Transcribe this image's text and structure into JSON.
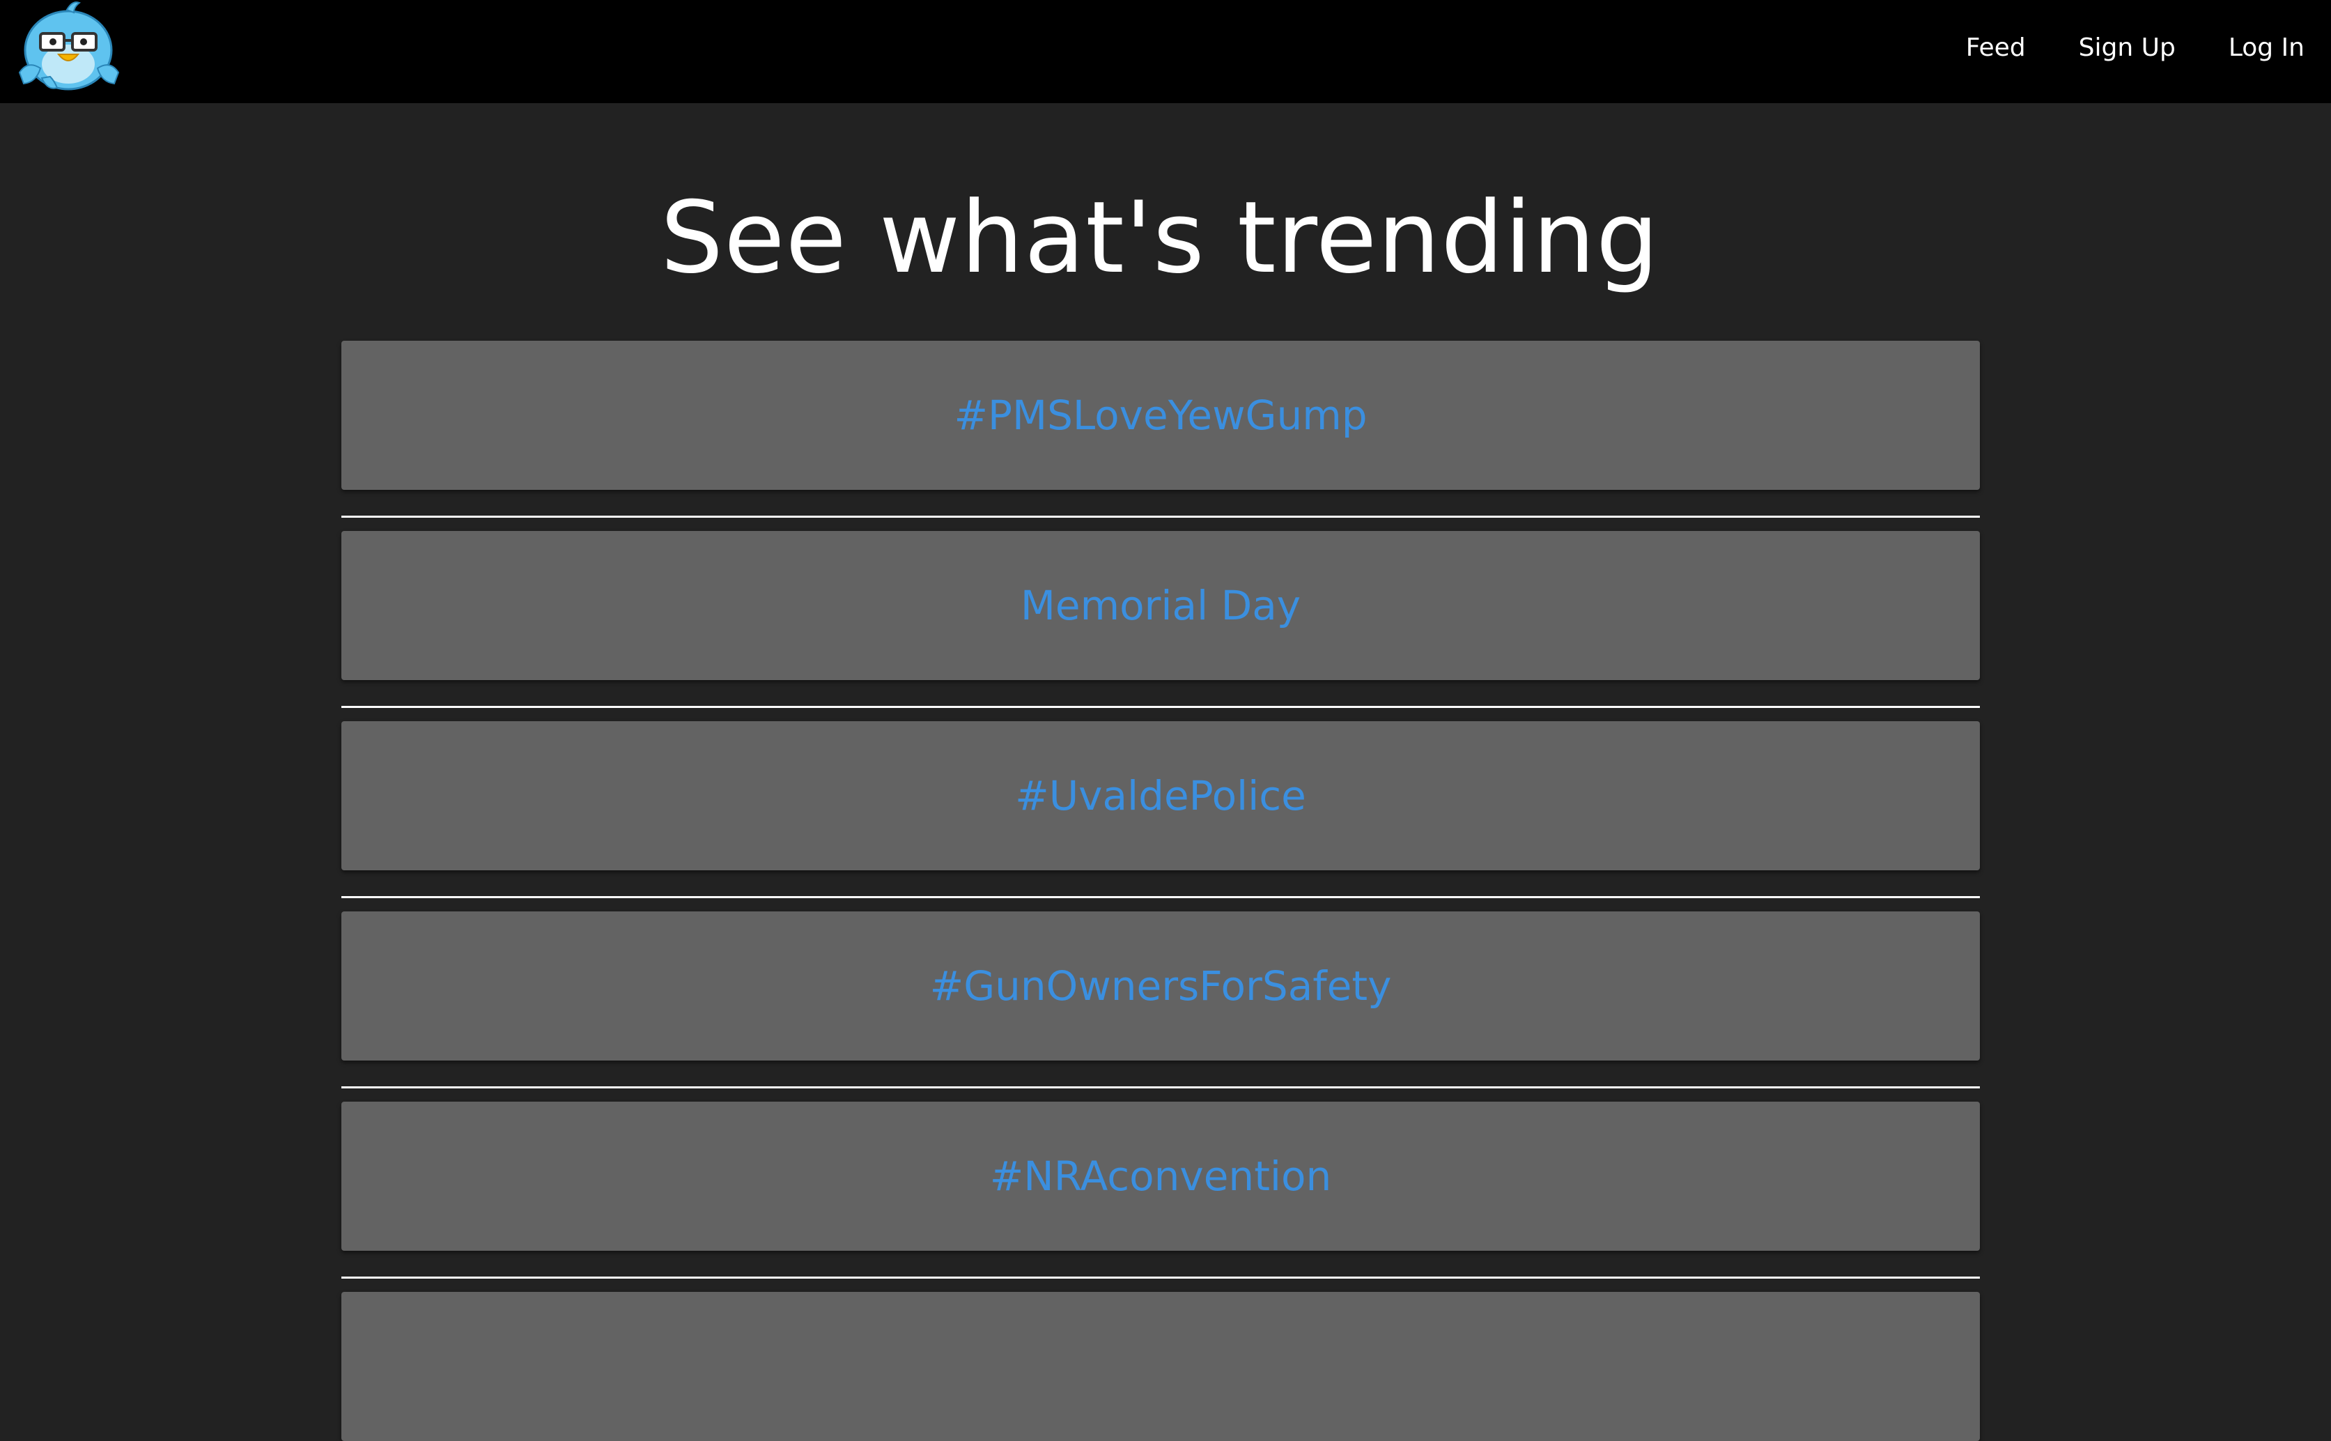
{
  "navbar": {
    "logo_icon": "bird-with-glasses-logo",
    "links": [
      "Feed",
      "Sign Up",
      "Log In"
    ]
  },
  "main": {
    "title": "See what's trending",
    "trends": [
      "#PMSLoveYewGump",
      "Memorial Day",
      "#UvaldePolice",
      "#GunOwnersForSafety",
      "#NRAconvention",
      ""
    ]
  },
  "colors": {
    "navbar_bg": "#000000",
    "page_bg": "#222222",
    "card_bg": "#636363",
    "link_blue": "#3b8fdf",
    "text_white": "#ffffff"
  }
}
